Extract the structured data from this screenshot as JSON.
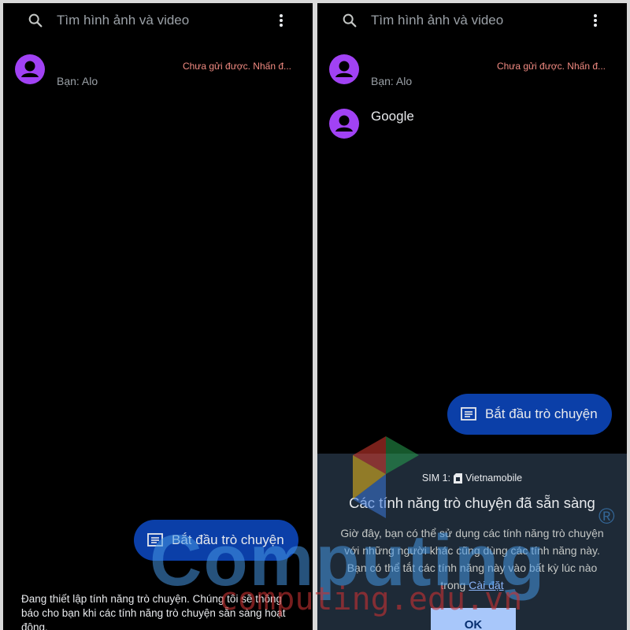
{
  "left_screen": {
    "search": {
      "placeholder": "Tìm hình ảnh và video"
    },
    "conversations": [
      {
        "avatar": "person-icon",
        "snippet": "Bạn: Alo",
        "status": "Chưa gửi được. Nhấn đ..."
      }
    ],
    "fab": {
      "label": "Bắt đầu trò chuyện",
      "icon": "chat-icon"
    },
    "footer_note": "Đang thiết lập tính năng trò chuyện. Chúng tôi sẽ thông báo cho bạn khi các tính năng trò chuyện sẵn sàng hoạt động."
  },
  "right_screen": {
    "search": {
      "placeholder": "Tìm hình ảnh và video"
    },
    "conversations": [
      {
        "avatar": "person-icon",
        "snippet": "Bạn: Alo",
        "status": "Chưa gửi được. Nhấn đ..."
      },
      {
        "avatar": "person-icon",
        "name": "Google"
      }
    ],
    "fab": {
      "label": "Bắt đầu trò chuyện",
      "icon": "chat-icon"
    },
    "sheet": {
      "sim_label": "SIM 1:",
      "carrier": "Vietnamobile",
      "title": "Các tính năng trò chuyện đã sẵn sàng",
      "body": "Giờ đây, bạn có thể sử dụng các tính năng trò chuyện với những người khác cũng dùng các tính năng này. Bạn có thể tắt các tính năng này vào bất kỳ lúc nào trong",
      "settings_link": "Cài đặt",
      "ok_label": "OK"
    }
  },
  "watermark": {
    "brand": "Computing",
    "registered": "®",
    "domain": "computing.edu.vn"
  },
  "colors": {
    "background": "#000000",
    "avatar": "#a142f4",
    "fab": "#0b3fa8",
    "error": "#f28b82",
    "sheet": "#1e2a37",
    "link": "#8ab4f8"
  }
}
